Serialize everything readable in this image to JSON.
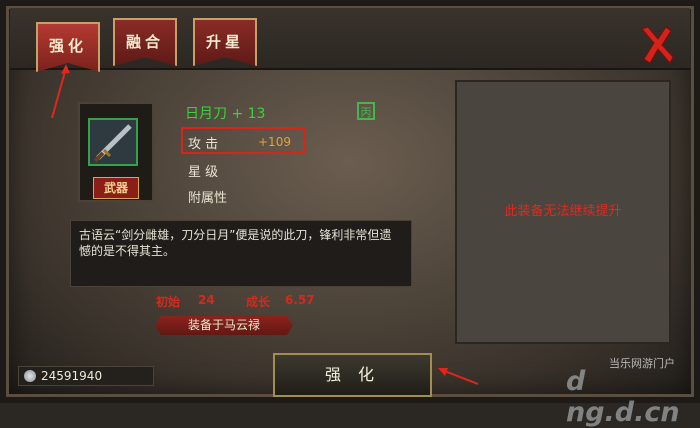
{
  "tabs": {
    "enhance": "强化",
    "fuse": "融合",
    "upgrade": "升星"
  },
  "item": {
    "name": "日月刀 + 13",
    "badge": "武器",
    "quality_glyph": "丙"
  },
  "stats": {
    "attack_label": "攻  击",
    "attack_value": "+109",
    "star_label": "星  级",
    "attr_label": "附属性"
  },
  "description": "古语云“剑分雌雄，刀分日月”便是说的此刀，锋利非常但遗憾的是不得其主。",
  "growth": {
    "initial_label": "初始",
    "initial_value": "24",
    "growth_label": "成长",
    "growth_value": "6.57"
  },
  "equipped_on": "装备于马云禄",
  "right_panel": {
    "message": "此装备无法继续提升"
  },
  "currency": {
    "amount": "24591940"
  },
  "action": {
    "enhance_button": "强 化"
  },
  "watermark": {
    "line1": "当乐网游门户",
    "line2": "d ng.d.cn"
  },
  "colors": {
    "accent_red": "#d9241d",
    "name_green": "#3cd23c",
    "value_gold": "#e0a431"
  },
  "icons": {
    "close": "close-icon",
    "sword": "sword-icon",
    "coin": "coin-icon"
  }
}
